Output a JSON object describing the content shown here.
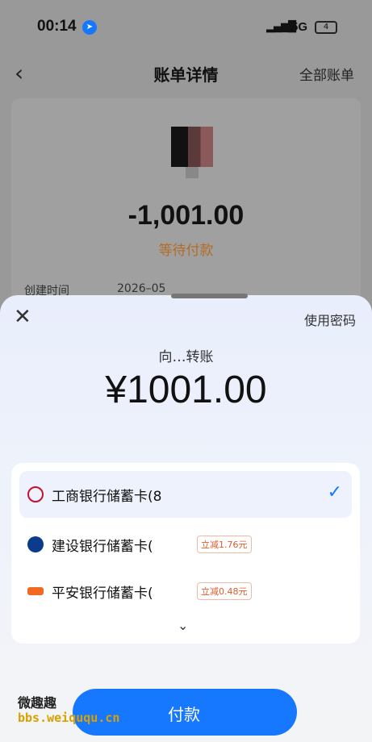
{
  "status_bar": {
    "time": "00:14",
    "network": "5G",
    "battery": "4"
  },
  "nav": {
    "title": "账单详情",
    "all_bills": "全部账单"
  },
  "bill": {
    "amount": "-1,001.00",
    "status": "等待付款",
    "created_label": "创建时间",
    "created_value": "2026–05"
  },
  "sheet": {
    "use_password": "使用密码",
    "pay_to": "向…转账",
    "amount": "¥1001.00"
  },
  "cards": [
    {
      "name": "工商银行储蓄卡(8",
      "selected": true,
      "promo": "",
      "icon_color": "#c8102e"
    },
    {
      "name": "建设银行储蓄卡(",
      "selected": false,
      "promo": "立减1.76元",
      "icon_color": "#0d3b8c"
    },
    {
      "name": "平安银行储蓄卡(",
      "selected": false,
      "promo": "立减0.48元",
      "icon_color": "#f26a21"
    }
  ],
  "pay_button": "付款",
  "watermark": {
    "line1": "微趣趣",
    "line2": "bbs.weiququ.cn"
  },
  "colors": {
    "primary": "#1677ff",
    "pending": "#b56b24",
    "promo": "#e05a2a"
  }
}
